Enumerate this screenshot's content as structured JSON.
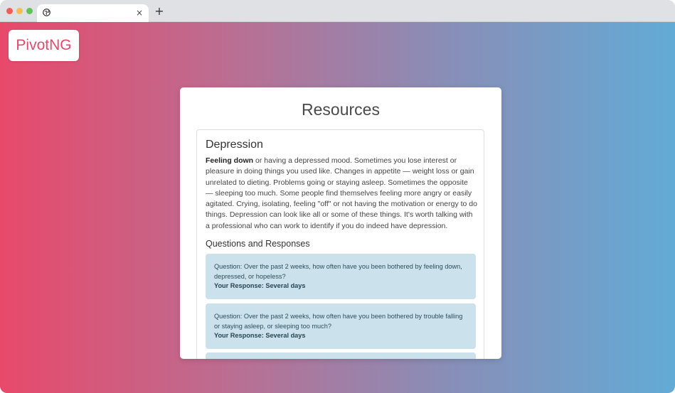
{
  "browser": {
    "tab_title": "",
    "close_glyph": "×",
    "new_tab_glyph": "+"
  },
  "logo": "PivotNG",
  "card": {
    "title": "Resources",
    "section": {
      "title": "Depression",
      "lead": "Feeling down",
      "text": " or having a depressed mood. Sometimes you lose interest or pleasure in doing things you used like. Changes in appetite — weight loss or gain unrelated to dieting. Problems going or staying asleep. Sometimes the opposite — sleeping too much. Some people find themselves feeling more angry or easily agitated. Crying, isolating, feeling \"off\" or not having the motivation or energy to do things. Depression can look like all or some of these things. It's worth talking with a professional who can work to identify if you do indeed have depression.",
      "qr_title": "Questions and Responses",
      "qa": [
        {
          "question": "Question: Over the past 2 weeks, how often have you been bothered by feeling down, depressed, or hopeless?",
          "response": "Your Response: Several days"
        },
        {
          "question": "Question: Over the past 2 weeks, how often have you been bothered by trouble falling or staying asleep, or sleeping too much?",
          "response": "Your Response: Several days"
        }
      ]
    }
  },
  "colors": {
    "gradient_left": "#e8496a",
    "gradient_right": "#62abd6",
    "brand": "#e2496b",
    "qa_background": "#cbe2ec"
  }
}
